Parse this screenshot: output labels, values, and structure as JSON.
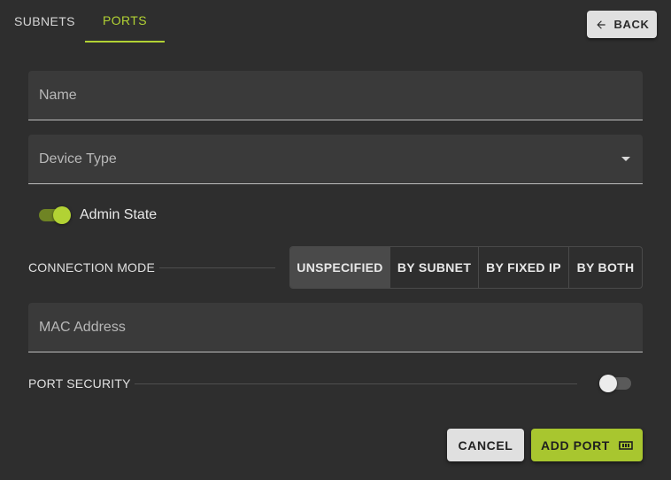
{
  "tabs": [
    {
      "label": "SUBNETS",
      "active": false
    },
    {
      "label": "PORTS",
      "active": true
    }
  ],
  "back_button": {
    "label": "BACK",
    "icon": "arrow-left-icon"
  },
  "fields": {
    "name": {
      "placeholder": "Name",
      "value": ""
    },
    "device_type": {
      "label": "Device Type",
      "value": ""
    },
    "mac_address": {
      "placeholder": "MAC Address",
      "value": ""
    }
  },
  "admin_state": {
    "label": "Admin State",
    "on": true
  },
  "connection_mode": {
    "label": "CONNECTION MODE",
    "options": [
      "UNSPECIFIED",
      "BY SUBNET",
      "BY FIXED IP",
      "BY BOTH"
    ],
    "selected": "UNSPECIFIED"
  },
  "port_security": {
    "label": "PORT SECURITY",
    "on": false
  },
  "actions": {
    "cancel_label": "CANCEL",
    "add_label": "ADD PORT",
    "add_icon": "network-port-icon"
  },
  "colors": {
    "accent": "#b2d234",
    "background": "#2e2e2e",
    "field_background": "#3a3a3a"
  }
}
